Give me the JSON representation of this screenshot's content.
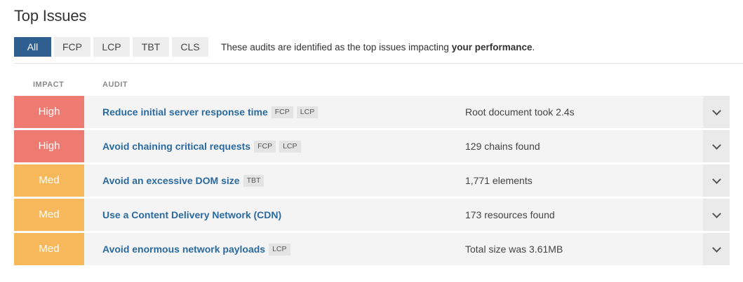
{
  "header": {
    "title": "Top Issues"
  },
  "filters": {
    "items": [
      {
        "label": "All",
        "active": true
      },
      {
        "label": "FCP",
        "active": false
      },
      {
        "label": "LCP",
        "active": false
      },
      {
        "label": "TBT",
        "active": false
      },
      {
        "label": "CLS",
        "active": false
      }
    ],
    "description_prefix": "These audits are identified as the top issues impacting ",
    "description_bold": "your performance",
    "description_suffix": "."
  },
  "table": {
    "columns": [
      "IMPACT",
      "AUDIT"
    ],
    "rows": [
      {
        "impact": "High",
        "level": "high",
        "audit": "Reduce initial server response time",
        "tags": [
          "FCP",
          "LCP"
        ],
        "result": "Root document took 2.4s"
      },
      {
        "impact": "High",
        "level": "high",
        "audit": "Avoid chaining critical requests",
        "tags": [
          "FCP",
          "LCP"
        ],
        "result": "129 chains found"
      },
      {
        "impact": "Med",
        "level": "med",
        "audit": "Avoid an excessive DOM size",
        "tags": [
          "TBT"
        ],
        "result": "1,771 elements"
      },
      {
        "impact": "Med",
        "level": "med",
        "audit": "Use a Content Delivery Network (CDN)",
        "tags": [],
        "result": "173 resources found"
      },
      {
        "impact": "Med",
        "level": "med",
        "audit": "Avoid enormous network payloads",
        "tags": [
          "LCP"
        ],
        "result": "Total size was 3.61MB"
      }
    ]
  },
  "colors": {
    "active_filter": "#2f5f91",
    "high": "#ee7b72",
    "med": "#f6b85a",
    "audit_link": "#2a6aa0"
  }
}
